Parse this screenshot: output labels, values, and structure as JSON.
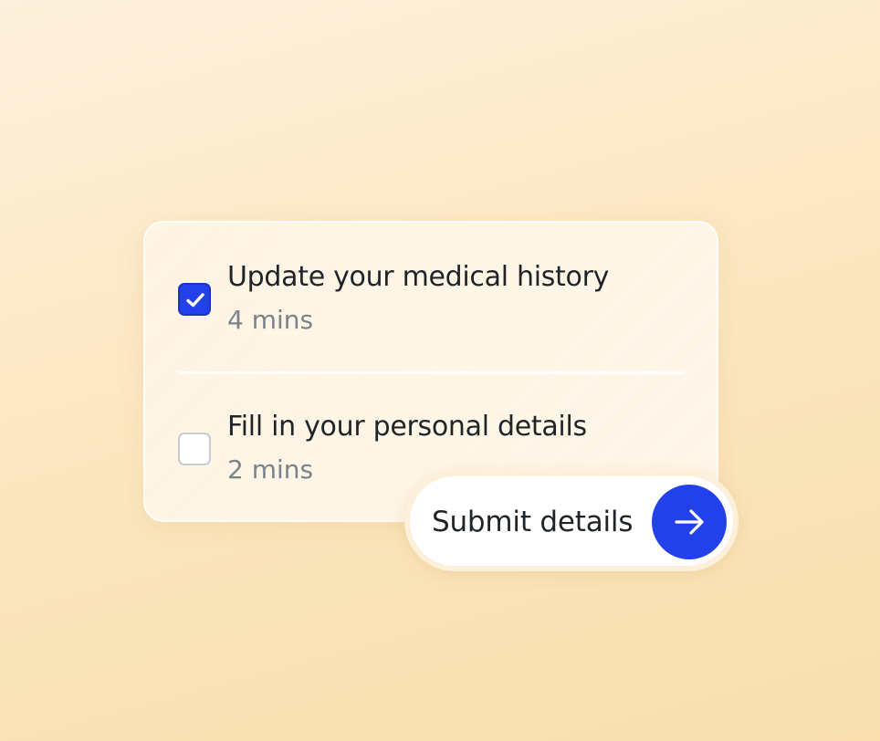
{
  "tasks": [
    {
      "title": "Update your medical history",
      "duration": "4 mins",
      "checked": true
    },
    {
      "title": "Fill in your personal details",
      "duration": "2 mins",
      "checked": false
    }
  ],
  "submit": {
    "label": "Submit details",
    "icon": "arrow-right-icon"
  },
  "colors": {
    "accent": "#2341ea",
    "text": "#1f2428",
    "muted": "#7a838b",
    "background": "#fce8c4"
  }
}
